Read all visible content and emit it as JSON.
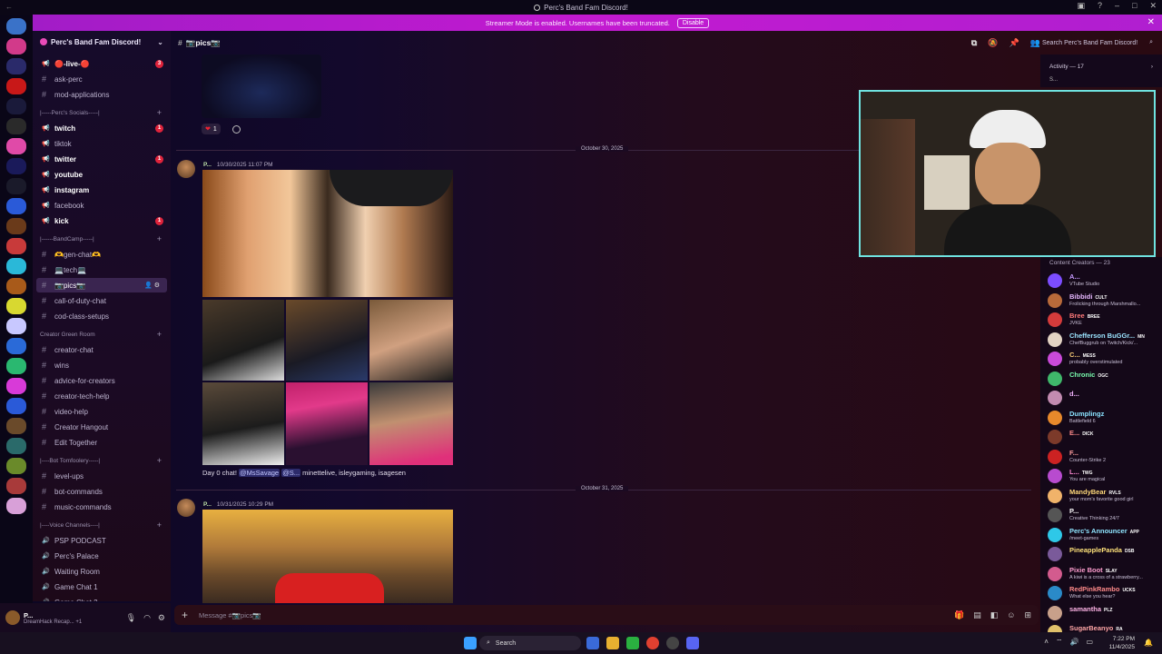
{
  "window": {
    "title": "Perc's Band Fam Discord!"
  },
  "streamer_bar": {
    "text": "Streamer Mode is enabled. Usernames have been truncated.",
    "button": "Disable"
  },
  "server": {
    "name": "Perc's Band Fam Discord!"
  },
  "channels": [
    {
      "label": "🔴-live-🔴",
      "type": "announce",
      "badge": "3",
      "bold": true
    },
    {
      "label": "ask-perc",
      "type": "text"
    },
    {
      "label": "mod-applications",
      "type": "text"
    },
    {
      "label": "|-----Perc's Socials-----|",
      "type": "category"
    },
    {
      "label": "twitch",
      "type": "announce",
      "badge": "1",
      "bold": true
    },
    {
      "label": "tiktok",
      "type": "announce"
    },
    {
      "label": "twitter",
      "type": "announce",
      "badge": "1",
      "bold": true
    },
    {
      "label": "youtube",
      "type": "announce",
      "bold": true
    },
    {
      "label": "instagram",
      "type": "announce",
      "bold": true
    },
    {
      "label": "facebook",
      "type": "announce"
    },
    {
      "label": "kick",
      "type": "announce",
      "badge": "1",
      "bold": true
    },
    {
      "label": "|------BandCamp-----|",
      "type": "category"
    },
    {
      "label": "🫶gen-chat🫶",
      "type": "text"
    },
    {
      "label": "💻tech💻",
      "type": "text"
    },
    {
      "label": "📷pics📷",
      "type": "text",
      "active": true
    },
    {
      "label": "call-of-duty-chat",
      "type": "text"
    },
    {
      "label": "cod-class-setups",
      "type": "text"
    },
    {
      "label": "Creator Green Room",
      "type": "category"
    },
    {
      "label": "creator-chat",
      "type": "text"
    },
    {
      "label": "wins",
      "type": "text"
    },
    {
      "label": "advice-for-creators",
      "type": "text"
    },
    {
      "label": "creator-tech-help",
      "type": "text"
    },
    {
      "label": "video-help",
      "type": "text"
    },
    {
      "label": "Creator Hangout",
      "type": "text"
    },
    {
      "label": "Edit Together",
      "type": "text"
    },
    {
      "label": "|----Bot Tomfoolery-----|",
      "type": "category"
    },
    {
      "label": "level-ups",
      "type": "text"
    },
    {
      "label": "bot-commands",
      "type": "text"
    },
    {
      "label": "music-commands",
      "type": "text"
    },
    {
      "label": "|----Voice Channels----|",
      "type": "category"
    },
    {
      "label": "PSP PODCAST",
      "type": "voice"
    },
    {
      "label": "Perc's Palace",
      "type": "voice"
    },
    {
      "label": "Waiting Room",
      "type": "voice"
    },
    {
      "label": "Game Chat 1",
      "type": "voice"
    },
    {
      "label": "Game Chat 2",
      "type": "voice"
    }
  ],
  "user": {
    "name": "P...",
    "status": "DreamHack Recap... +1"
  },
  "header": {
    "channel": "📷pics📷",
    "search": "Search Perc's Band Fam Discord!"
  },
  "messages": {
    "reaction_count": "1",
    "divider1": "October 30, 2025",
    "msg1": {
      "author": "P...",
      "time": "10/30/2025 11:07 PM",
      "caption_prefix": "Day 0 chat! ",
      "mention1": "@MsSavage",
      "mention2": "@S...",
      "caption_suffix": " minettelive, isleygaming, isagesen"
    },
    "divider2": "October 31, 2025",
    "msg2": {
      "author": "P...",
      "time": "10/31/2025 10:29 PM"
    }
  },
  "composer": {
    "placeholder": "Message #📷pics📷"
  },
  "activity": {
    "label": "Activity — 17",
    "sub": "S..."
  },
  "members": {
    "heading": "Content Creators — 23",
    "list": [
      {
        "name": "A...",
        "status": "VTube Studio",
        "color": "#c79bff",
        "av": "#7c4dff"
      },
      {
        "name": "Bibbidi",
        "status": "Frolicking through Marshmallo...",
        "color": "#e6b8ff",
        "av": "#b86a3a",
        "tag": "CULT"
      },
      {
        "name": "Bree",
        "status": "JVKE",
        "color": "#ff7a7a",
        "av": "#d43b3b",
        "tag": "BREE"
      },
      {
        "name": "Chefferson BuGGr...",
        "status": "ChefBuggrub on Twitch/Kick/...",
        "color": "#9be4ff",
        "av": "#e2d3c3",
        "tag": "MN"
      },
      {
        "name": "C...",
        "status": "probably overstimulated",
        "color": "#ffd27a",
        "av": "#c94ad9",
        "tag": "MESS"
      },
      {
        "name": "Chronic",
        "status": "",
        "color": "#7affb0",
        "av": "#3fb86a",
        "tag": "OGC"
      },
      {
        "name": "d...",
        "status": "",
        "color": "#f4b4ff",
        "av": "#c28bb0"
      },
      {
        "name": "Dumplingz",
        "status": "Battlefield 6",
        "color": "#8be3ff",
        "av": "#e8892b"
      },
      {
        "name": "E...",
        "status": "",
        "color": "#ff8a8a",
        "av": "#7c3a2a",
        "tag": "DICK"
      },
      {
        "name": "F...",
        "status": "Counter-Strike 2",
        "color": "#ff9e9e",
        "av": "#cc2222"
      },
      {
        "name": "L...",
        "status": "You are magical",
        "color": "#ff8ad4",
        "av": "#b84bcf",
        "tag": "TWG"
      },
      {
        "name": "MandyBear",
        "status": "your mom's favorite good girl",
        "color": "#ffd97a",
        "av": "#f0b36a",
        "tag": "RVLS"
      },
      {
        "name": "P...",
        "status": "Creative Thinking 24/7",
        "color": "#ffffff",
        "av": "#555555"
      },
      {
        "name": "Perc's Announcer",
        "status": "/meet-games",
        "color": "#8fe5ff",
        "av": "#2ec8e8",
        "tag": "APP"
      },
      {
        "name": "PineapplePanda",
        "status": "",
        "color": "#ffe27a",
        "av": "#7a5a9a",
        "tag": "DSB"
      },
      {
        "name": "Pixie Boot",
        "status": "A kiwi is a cross of a strawberry...",
        "color": "#ff9ecf",
        "av": "#d35b8e",
        "tag": "SLAY"
      },
      {
        "name": "RedPinkRambo",
        "status": "What else you hear?",
        "color": "#ff8a8a",
        "av": "#2a8ac8",
        "tag": "UCKS"
      },
      {
        "name": "samantha",
        "status": "",
        "color": "#ffb4e6",
        "av": "#c8a08a",
        "tag": "PLZ"
      },
      {
        "name": "SugarBeanyo",
        "status": "",
        "color": "#ffa6a6",
        "av": "#e0c06a",
        "tag": "RA"
      }
    ]
  },
  "taskbar": {
    "search": "Search",
    "time": "7:22 PM",
    "date": "11/4/2025"
  },
  "colors": {
    "accent": "#c21ad0",
    "badge": "#e0233b",
    "webcam_border": "#6fe3e0"
  }
}
